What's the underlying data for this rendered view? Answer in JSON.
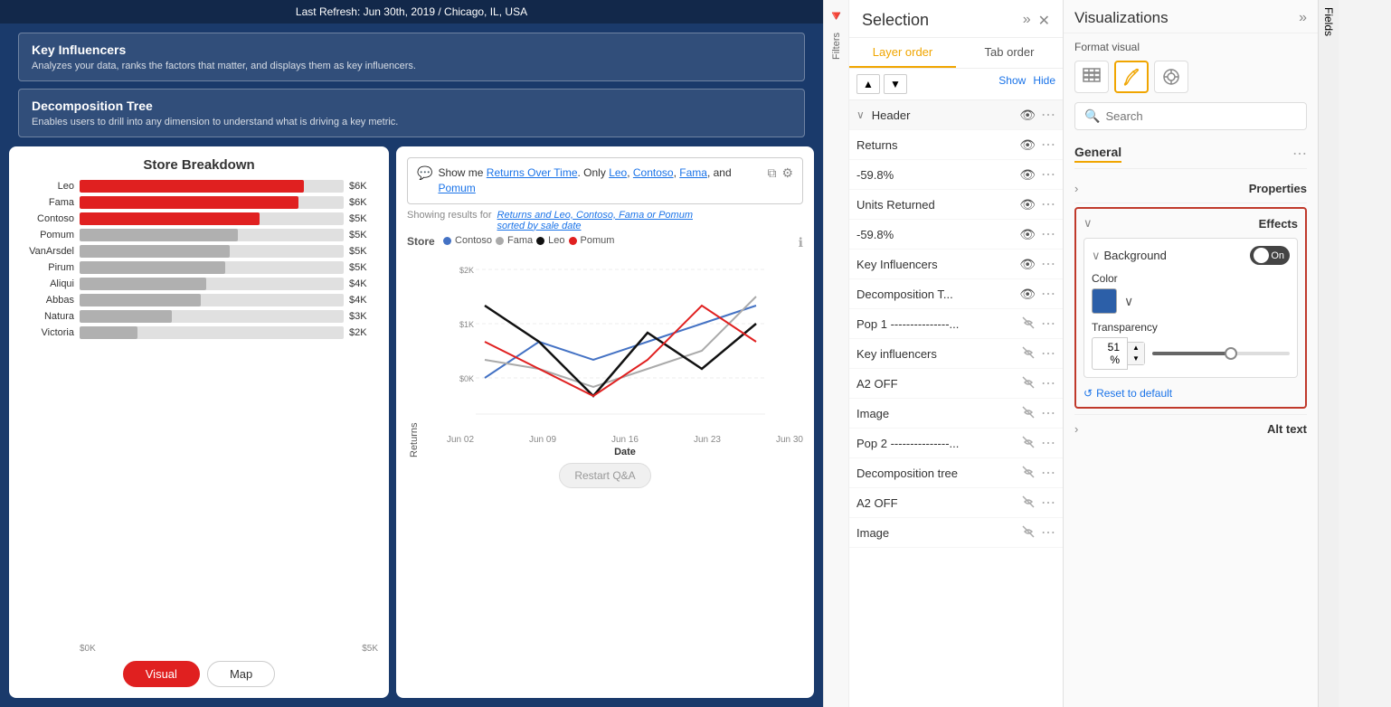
{
  "topbar": {
    "refresh_text": "Last Refresh: Jun 30th, 2019 / Chicago, IL, USA"
  },
  "viz_cards": [
    {
      "title": "Key Influencers",
      "desc": "Analyzes your data, ranks the factors that matter, and displays them as key influencers."
    },
    {
      "title": "Decomposition Tree",
      "desc": "Enables users to drill into any dimension to understand what is driving a key metric."
    }
  ],
  "store_breakdown": {
    "title": "Store Breakdown",
    "bars": [
      {
        "label": "Leo",
        "value": "$6K",
        "pct": 85,
        "colored": true
      },
      {
        "label": "Fama",
        "value": "$6K",
        "pct": 83,
        "colored": true
      },
      {
        "label": "Contoso",
        "value": "$5K",
        "pct": 68,
        "colored": true
      },
      {
        "label": "Pomum",
        "value": "$5K",
        "pct": 60,
        "colored": false
      },
      {
        "label": "VanArsdel",
        "value": "$5K",
        "pct": 57,
        "colored": false
      },
      {
        "label": "Pirum",
        "value": "$5K",
        "pct": 55,
        "colored": false
      },
      {
        "label": "Aliqui",
        "value": "$4K",
        "pct": 48,
        "colored": false
      },
      {
        "label": "Abbas",
        "value": "$4K",
        "pct": 46,
        "colored": false
      },
      {
        "label": "Natura",
        "value": "$3K",
        "pct": 35,
        "colored": false
      },
      {
        "label": "Victoria",
        "value": "$2K",
        "pct": 22,
        "colored": false
      }
    ],
    "x_labels": [
      "$0K",
      "$5K"
    ],
    "tabs": [
      "Visual",
      "Map"
    ]
  },
  "qa_chart": {
    "bubble_icon": "💬",
    "query_text_parts": [
      "Show me ",
      "Returns Over Time",
      ". Only ",
      "Leo",
      ", ",
      "Contoso",
      ", ",
      "Fama",
      ", and ",
      "Pomum"
    ],
    "showing_label": "Showing results for",
    "showing_link": "Returns and Leo, Contoso, Fama or Pomum",
    "sorted_label": "sorted by sale date",
    "store_label": "Store",
    "legend": [
      {
        "name": "Contoso",
        "color": "#4472c4"
      },
      {
        "name": "Fama",
        "color": "#a0a0a0"
      },
      {
        "name": "Leo",
        "color": "#222222"
      },
      {
        "name": "Pomum",
        "color": "#e02020"
      }
    ],
    "y_labels": [
      "$2K",
      "$1K",
      "$0K"
    ],
    "x_labels": [
      "Jun 02",
      "Jun 09",
      "Jun 16",
      "Jun 23",
      "Jun 30"
    ],
    "x_axis_label": "Date",
    "y_axis_label": "Returns",
    "restart_btn": "Restart Q&A"
  },
  "selection": {
    "title": "Selection",
    "collapse_icon": "«",
    "expand_icon": "»",
    "close_icon": "✕",
    "filters_label": "Filters",
    "tabs": [
      "Layer order",
      "Tab order"
    ],
    "up_btn": "▲",
    "down_btn": "▼",
    "show_label": "Show",
    "hide_label": "Hide",
    "layers": [
      {
        "name": "Header",
        "visible": true,
        "is_header": true,
        "chevron": "∨"
      },
      {
        "name": "Returns",
        "visible": true
      },
      {
        "name": "-59.8%",
        "visible": true
      },
      {
        "name": "Units Returned",
        "visible": true
      },
      {
        "name": "-59.8%",
        "visible": true
      },
      {
        "name": "Key Influencers",
        "visible": true
      },
      {
        "name": "Decomposition T...",
        "visible": true
      },
      {
        "name": "Pop 1 ---------------...",
        "visible": false
      },
      {
        "name": "Key influencers",
        "visible": false
      },
      {
        "name": "A2 OFF",
        "visible": false
      },
      {
        "name": "Image",
        "visible": false
      },
      {
        "name": "Pop 2 ---------------...",
        "visible": false
      },
      {
        "name": "Decomposition tree",
        "visible": false
      },
      {
        "name": "A2 OFF",
        "visible": false
      },
      {
        "name": "Image",
        "visible": false
      }
    ]
  },
  "visualizations": {
    "title": "Visualizations",
    "fields_label": "Fields",
    "expand_icon": "»",
    "format_visual_label": "Format visual",
    "icons": [
      {
        "name": "table-grid-icon",
        "symbol": "⊞"
      },
      {
        "name": "paint-brush-icon",
        "symbol": "🖌"
      },
      {
        "name": "analytics-icon",
        "symbol": "◎"
      }
    ],
    "search": {
      "placeholder": "Search",
      "icon": "🔍"
    },
    "general_section": {
      "title": "General",
      "more_icon": "⋯"
    },
    "properties_section": {
      "title": "Properties",
      "chevron": "›"
    },
    "effects_section": {
      "title": "Effects",
      "chevron": "∨"
    },
    "background": {
      "title": "Background",
      "toggle_label": "On",
      "chevron": "∨"
    },
    "color": {
      "label": "Color",
      "swatch_color": "#2c5fa8"
    },
    "transparency": {
      "label": "Transparency",
      "value": "51",
      "unit": "%"
    },
    "reset_label": "Reset to default",
    "alt_text": {
      "label": "Alt text",
      "chevron": "›"
    }
  }
}
